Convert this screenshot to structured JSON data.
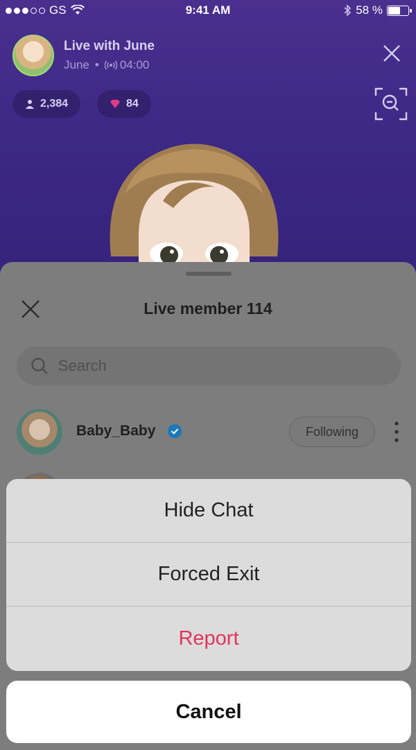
{
  "status_bar": {
    "carrier": "GS",
    "time": "9:41 AM",
    "battery_percent": "58 %",
    "battery_level": 0.58
  },
  "live": {
    "title": "Live with June",
    "host": "June",
    "separator": "•",
    "duration": "04:00",
    "viewers": "2,384",
    "gems": "84"
  },
  "sheet": {
    "title": "Live member 114",
    "search_placeholder": "Search",
    "members": [
      {
        "name": "Baby_Baby",
        "verified": true,
        "follow_label": "Following"
      }
    ]
  },
  "action_sheet": {
    "items": [
      {
        "label": "Hide Chat",
        "style": "default"
      },
      {
        "label": "Forced Exit",
        "style": "default"
      },
      {
        "label": "Report",
        "style": "destructive"
      }
    ],
    "cancel_label": "Cancel"
  },
  "colors": {
    "live_background": "#4a2f8f",
    "destructive": "#e2345a",
    "verified_badge": "#1b79b9"
  },
  "icons": [
    "wifi-icon",
    "bluetooth-icon",
    "close-icon",
    "broadcast-icon",
    "person-icon",
    "gem-icon",
    "zoom-out-icon",
    "search-icon",
    "verified-icon",
    "more-vertical-icon"
  ]
}
